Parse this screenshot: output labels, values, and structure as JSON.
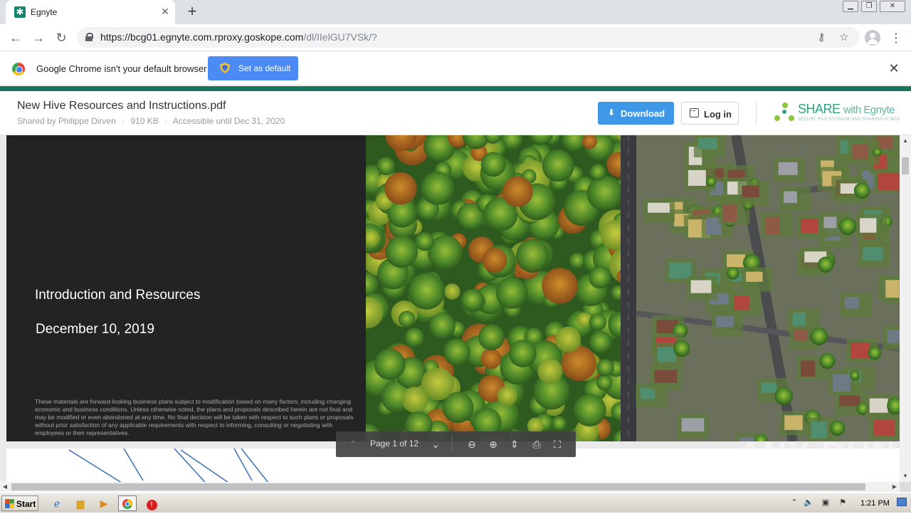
{
  "browser": {
    "tab_title": "Egnyte",
    "tab_favicon": "egnyte-icon",
    "new_tab_glyph": "+",
    "url_host": "https://bcg01.egnyte.com.rproxy.goskope.com",
    "url_path": "/dl/IIelGU7VSk/?"
  },
  "infobar": {
    "message": "Google Chrome isn't your default browser",
    "button_label": "Set as default"
  },
  "share_header": {
    "file_name": "New Hive Resources and Instructions.pdf",
    "shared_by": "Shared by Philippe Dirven",
    "file_size": "910 KB",
    "accessible_until": "Accessible until Dec 31, 2020",
    "meta_separator": "·",
    "download_label": "Download",
    "login_label": "Log in",
    "brand_share": "SHARE",
    "brand_with": "with Egnyte",
    "brand_tagline": "SECURE FILE STORAGE AND SHARING AT BCG"
  },
  "slide": {
    "title": "Introduction and Resources",
    "date": "December 10, 2019",
    "disclaimer": "These materials are forward-looking business plans subject to modification based on many factors, including changing economic and business conditions. Unless otherwise noted, the plans and proposals described herein are not final and may be modified or even abandoned at any time. No final decision will be taken with respect to such plans or proposals without prior satisfaction of any applicable requirements with respect to informing, consulting or negotiating with employees or their representatives."
  },
  "pager": {
    "page_text": "Page 1 of 12"
  },
  "watermark": "ANY RUN",
  "taskbar": {
    "start_label": "Start",
    "clock": "1:21 PM"
  },
  "colors": {
    "egnyte_green": "#17735a",
    "download_blue": "#3f97e8",
    "chrome_button_blue": "#4c8bf5",
    "slide_dark": "#232325"
  }
}
